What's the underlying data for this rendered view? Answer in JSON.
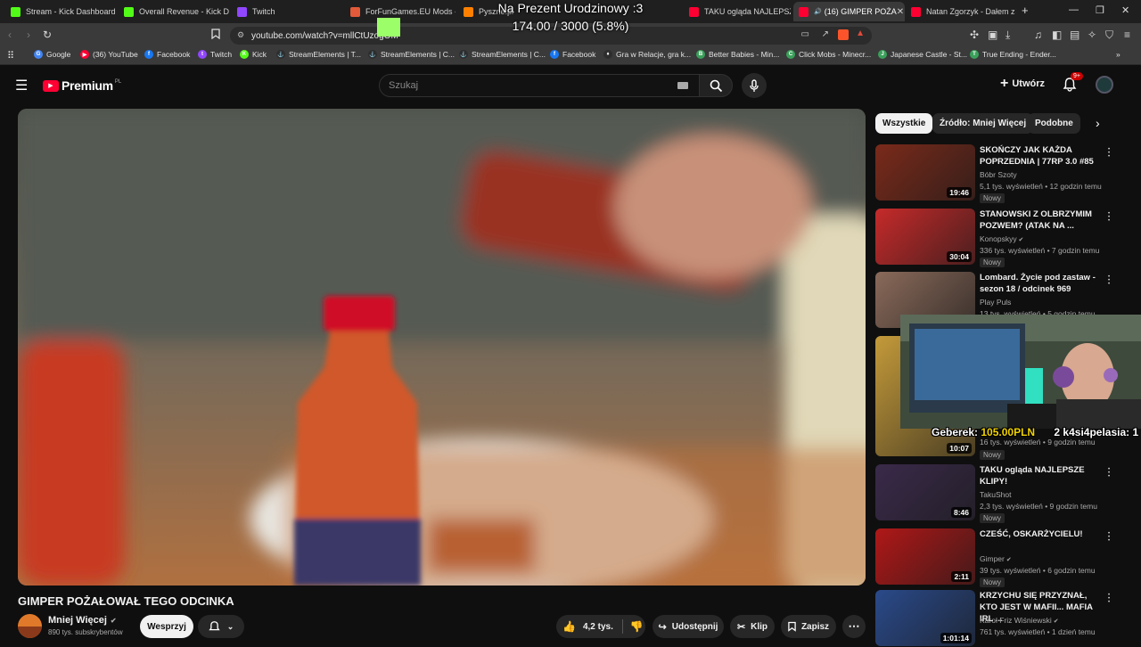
{
  "overlay": {
    "title": "Na Prezent Urodzinowy :3",
    "progress_text": "174.00 / 3000 (5.8%)",
    "progress_fraction": 0.058,
    "donation_name": "Geberek:",
    "donation_amount": "105.00PLN",
    "donation_extra": "2 k4si4pelasia: 1"
  },
  "tabs": [
    {
      "label": "Stream - Kick Dashboard",
      "icon": "kick-icon",
      "color": "#53fc18"
    },
    {
      "label": "Overall Revenue - Kick Da",
      "icon": "kick-icon",
      "color": "#53fc18"
    },
    {
      "label": "Twitch",
      "icon": "twitch-icon",
      "color": "#9146ff"
    },
    {
      "label": "ForFunGames.EU Mods - A",
      "icon": "mods-icon",
      "color": "#e25a3a"
    },
    {
      "label": "Pyszne.pl",
      "icon": "pyszne-icon",
      "color": "#ff8000"
    },
    {
      "label": "TAKU ogląda NAJLEPSZE",
      "icon": "youtube-icon",
      "color": "#ff0033"
    },
    {
      "label": "(16) GIMPER POŻA",
      "icon": "youtube-icon",
      "color": "#ff0033"
    },
    {
      "label": "Natan Zgorzyk - Dałem z",
      "icon": "youtube-icon",
      "color": "#ff0033"
    }
  ],
  "new_tab": "+",
  "address": {
    "url": "youtube.com/watch?v=mllCtUzogOM"
  },
  "bookmarks": [
    {
      "label": "Google",
      "color": "#4285f4",
      "glyph": "G"
    },
    {
      "label": "(36) YouTube",
      "color": "#ff0033",
      "glyph": "▶"
    },
    {
      "label": "Facebook",
      "color": "#1877f2",
      "glyph": "f"
    },
    {
      "label": "Twitch",
      "color": "#9146ff",
      "glyph": "t"
    },
    {
      "label": "Kick",
      "color": "#53fc18",
      "glyph": "K"
    },
    {
      "label": "StreamElements | T...",
      "color": "#2d2d2d",
      "glyph": "⚓"
    },
    {
      "label": "StreamElements | C...",
      "color": "#2d2d2d",
      "glyph": "⚓"
    },
    {
      "label": "StreamElements | C...",
      "color": "#2d2d2d",
      "glyph": "⚓"
    },
    {
      "label": "Facebook",
      "color": "#1877f2",
      "glyph": "f"
    },
    {
      "label": "Gra w Relacje, gra k...",
      "color": "#2d2d2d",
      "glyph": "♦"
    },
    {
      "label": "Better Babies - Min...",
      "color": "#3aa05a",
      "glyph": "B"
    },
    {
      "label": "Click Mobs - Minecr...",
      "color": "#3aa05a",
      "glyph": "C"
    },
    {
      "label": "Japanese Castle - St...",
      "color": "#3aa05a",
      "glyph": "J"
    },
    {
      "label": "True Ending - Ender...",
      "color": "#3aa05a",
      "glyph": "T"
    }
  ],
  "youtube": {
    "logo_text": "Premium",
    "logo_region": "PL",
    "search_placeholder": "Szukaj",
    "create_label": "Utwórz",
    "notifications_badge": "9+"
  },
  "video": {
    "title": "GIMPER POŻAŁOWAŁ TEGO ODCINKA",
    "channel": "Mniej Więcej",
    "subscribers": "890 tys. subskrybentów",
    "support_label": "Wesprzyj",
    "likes": "4,2 tys.",
    "share_label": "Udostępnij",
    "clip_label": "Klip",
    "save_label": "Zapisz"
  },
  "chips": [
    "Wszystkie",
    "Źródło: Mniej Więcej",
    "Podobne"
  ],
  "recommendations": [
    {
      "title": "SKOŃCZY JAK KAŻDA POPRZEDNIA | 77RP 3.0 #85",
      "channel": "Bóbr Szoty",
      "verified": false,
      "meta": "5,1 tys. wyświetleń • 12 godzin temu",
      "badge": "Nowy",
      "duration": "19:46",
      "thumb_color": "#7a2a1a"
    },
    {
      "title": "STANOWSKI Z OLBRZYMIM POZWEM? (ATAK NA ...",
      "channel": "Konopskyy",
      "verified": true,
      "meta": "336 tys. wyświetleń • 7 godzin temu",
      "badge": "Nowy",
      "duration": "30:04",
      "thumb_color": "#c62a2a"
    },
    {
      "title": "Lombard. Życie pod zastaw - sezon 18 / odcinek 969",
      "channel": "Play Puls",
      "verified": false,
      "meta": "13 tys. wyświetleń • 5 godzin temu",
      "badge": "",
      "duration": "",
      "thumb_color": "#8a6a5a"
    },
    {
      "title": "",
      "channel": "",
      "verified": false,
      "meta": "16 tys. wyświetleń • 9 godzin temu",
      "badge": "Nowy",
      "duration": "10:07",
      "thumb_color": "#c49a3a"
    },
    {
      "title": "TAKU ogląda NAJLEPSZE KLIPY!",
      "channel": "TakuShot",
      "verified": false,
      "meta": "2,3 tys. wyświetleń • 9 godzin temu",
      "badge": "Nowy",
      "duration": "8:46",
      "thumb_color": "#3a2a4a"
    },
    {
      "title": "CZEŚĆ, OSKARŻYCIELU!",
      "channel": "Gimper",
      "verified": true,
      "meta": "39 tys. wyświetleń • 6 godzin temu",
      "badge": "Nowy",
      "duration": "2:11",
      "thumb_color": "#b01818"
    },
    {
      "title": "KRZYCHU SIĘ PRZYZNAŁ, KTO JEST W MAFII... MAFIA IRL ...",
      "channel": "Karol Friz Wiśniewski",
      "verified": true,
      "meta": "761 tys. wyświetleń • 1 dzień temu",
      "badge": "",
      "duration": "1:01:14",
      "thumb_color": "#2a4a8a"
    }
  ]
}
